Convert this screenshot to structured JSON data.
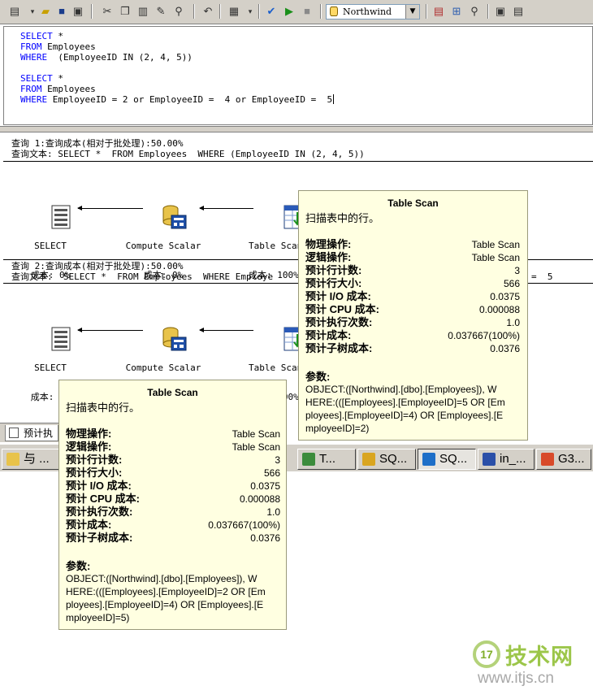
{
  "toolbar": {
    "database": "Northwind"
  },
  "editor": {
    "lines": [
      [
        "SELECT",
        " *"
      ],
      [
        "FROM",
        " Employees"
      ],
      [
        "WHERE",
        "  (EmployeeID IN (2, 4, 5))"
      ],
      [
        "",
        ""
      ],
      [
        "SELECT",
        " *"
      ],
      [
        "FROM",
        " Employees"
      ],
      [
        "WHERE",
        " EmployeeID = 2 or EmployeeID =  4 or EmployeeID =  5"
      ]
    ]
  },
  "plan": {
    "query1": {
      "header": "查询 1:查询成本(相对于批处理):50.00%",
      "text": "查询文本: SELECT *  FROM Employees  WHERE (EmployeeID IN (2, 4, 5))"
    },
    "query2": {
      "header": "查询 2:查询成本(相对于批处理):50.00%",
      "text": "查询文本:  SELECT *  FROM Employees  WHERE Employe",
      "text_tail": "=  5"
    },
    "nodes": {
      "select": {
        "name": "SELECT",
        "cost": "成本: 0%"
      },
      "compute": {
        "name": "Compute Scalar",
        "cost": "成本: 0%"
      },
      "scan": {
        "name": "Table Scan",
        "cost": "成本: 100%"
      }
    }
  },
  "tooltip_labels": {
    "title": "Table Scan",
    "desc": "扫描表中的行。",
    "physical_op": "物理操作:",
    "logical_op": "逻辑操作:",
    "est_rows": "预计行计数:",
    "est_row_size": "预计行大小:",
    "est_io": "预计 I/O 成本:",
    "est_cpu": "预计 CPU 成本:",
    "est_exec": "预计执行次数:",
    "est_cost": "预计成本:",
    "est_subtree": "预计子树成本:",
    "params": "参数:"
  },
  "tooltip1": {
    "physical_op": "Table Scan",
    "logical_op": "Table Scan",
    "est_rows": "3",
    "est_row_size": "566",
    "est_io": "0.0375",
    "est_cpu": "0.000088",
    "est_exec": "1.0",
    "est_cost": "0.037667(100%)",
    "est_subtree": "0.0376",
    "params": "OBJECT:([Northwind].[dbo].[Employees]), W\nHERE:(([Employees].[EmployeeID]=5 OR [Em\nployees].[EmployeeID]=4) OR [Employees].[E\nmployeeID]=2)"
  },
  "tooltip2": {
    "physical_op": "Table Scan",
    "logical_op": "Table Scan",
    "est_rows": "3",
    "est_row_size": "566",
    "est_io": "0.0375",
    "est_cpu": "0.000088",
    "est_exec": "1.0",
    "est_cost": "0.037667(100%)",
    "est_subtree": "0.0376",
    "params": "OBJECT:([Northwind].[dbo].[Employees]), W\nHERE:(([Employees].[EmployeeID]=2 OR [Em\nployees].[EmployeeID]=4) OR [Employees].[E\nmployeeID]=5)"
  },
  "bottom_tab": "预计执",
  "taskbar": [
    {
      "label": "与 ...",
      "icon_color": "#e8c34a",
      "active": false
    },
    {
      "label": "T...",
      "icon_color": "#3c8c3c",
      "active": false
    },
    {
      "label": "SQ...",
      "icon_color": "#d9a520",
      "active": false
    },
    {
      "label": "SQ...",
      "icon_color": "#1e6fc8",
      "active": true
    },
    {
      "label": "in_...",
      "icon_color": "#2a4fa8",
      "active": false
    },
    {
      "label": "G3...",
      "icon_color": "#d84a2a",
      "active": false
    }
  ],
  "watermark": {
    "logo": "17",
    "brand": "技术网",
    "url": "www.itjs.cn"
  }
}
